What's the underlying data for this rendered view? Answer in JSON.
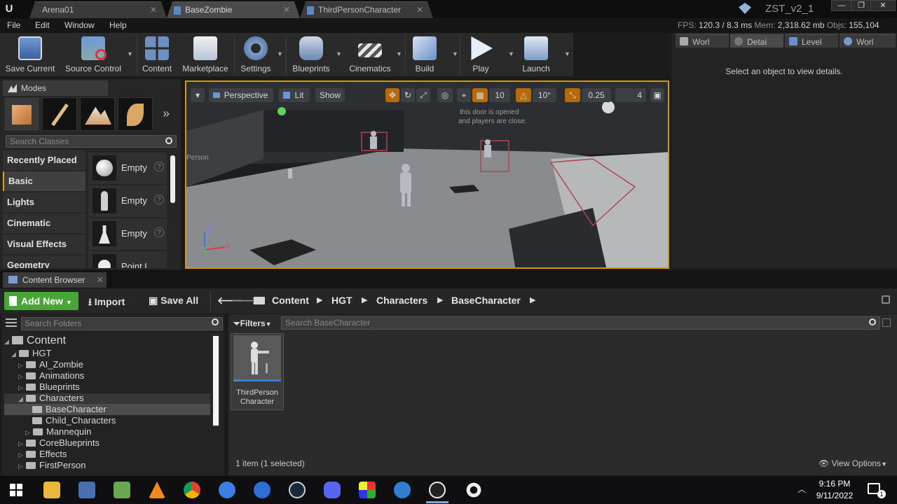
{
  "window": {
    "tabs": [
      "Arena01",
      "BaseZombie",
      "ThirdPersonCharacter"
    ],
    "project_name": "ZST_v2_1",
    "controls": [
      "—",
      "❐",
      "✕"
    ]
  },
  "menu": [
    "File",
    "Edit",
    "Window",
    "Help"
  ],
  "stats": {
    "fps_label": "FPS:",
    "fps_value": "120.3",
    "ms_value": "/ 8.3 ms",
    "mem_label": "Mem:",
    "mem_value": "2,318.62 mb",
    "objs_label": "Objs:",
    "objs_value": "155,104"
  },
  "toolbar": {
    "save_current": "Save Current",
    "source_control": "Source Control",
    "content": "Content",
    "marketplace": "Marketplace",
    "settings": "Settings",
    "blueprints": "Blueprints",
    "cinematics": "Cinematics",
    "build": "Build",
    "play": "Play",
    "launch": "Launch"
  },
  "right_panel": {
    "tabs": [
      "Worl",
      "Detai",
      "Level",
      "Worl"
    ],
    "empty_message": "Select an object to view details."
  },
  "modes": {
    "title": "Modes",
    "more": "»",
    "search_placeholder": "Search Classes",
    "categories": [
      "Recently Placed",
      "Basic",
      "Lights",
      "Cinematic",
      "Visual Effects",
      "Geometry"
    ],
    "items": [
      "Empty",
      "Empty",
      "Empty",
      "Point L"
    ]
  },
  "viewport": {
    "perspective": "Perspective",
    "lit": "Lit",
    "show": "Show",
    "grid_snap": "10",
    "rot_snap": "10°",
    "scale_snap": "0.25",
    "camera_speed": "4",
    "scene_text_1": "this door is opened",
    "scene_text_2": "and players are close.",
    "scene_text_3": "Person",
    "axis_z": "Z",
    "axis_x": "X",
    "axis_y": "Y"
  },
  "content_browser": {
    "tab_label": "Content Browser",
    "add_new": "Add New",
    "import": "Import",
    "save_all": "Save All",
    "breadcrumb": [
      "Content",
      "HGT",
      "Characters",
      "BaseCharacter"
    ],
    "search_folders_placeholder": "Search Folders",
    "filters": "Filters",
    "search_assets_placeholder": "Search BaseCharacter",
    "tree": {
      "root": "Content",
      "hgt": "HGT",
      "children": [
        "AI_Zombie",
        "Animations",
        "Blueprints",
        "Characters"
      ],
      "characters_children": [
        "BaseCharacter",
        "Child_Characters",
        "Mannequin"
      ],
      "rest": [
        "CoreBlueprints",
        "Effects",
        "FirstPerson"
      ]
    },
    "asset_name_line1": "ThirdPerson",
    "asset_name_line2": "Character",
    "item_count": "1 item (1 selected)",
    "view_options": "View Options"
  },
  "taskbar": {
    "time": "9:16 PM",
    "date": "9/11/2022",
    "notification_count": "1"
  }
}
